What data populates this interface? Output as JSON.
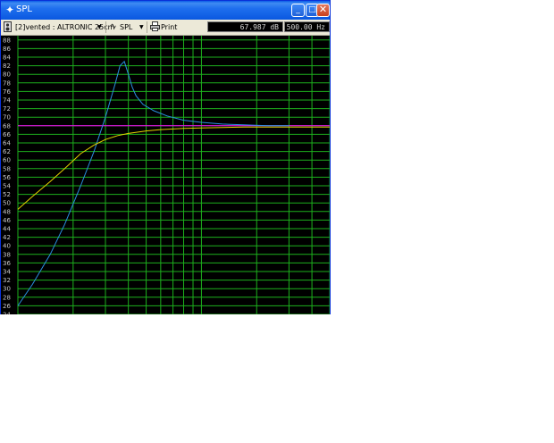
{
  "window": {
    "title": "SPL",
    "controls": {
      "minimize": "_",
      "maximize": "□",
      "close": "✕"
    }
  },
  "toolbar": {
    "driver_select": "[2]vented : ALTRONIC 25cm",
    "mode_select": "SPL",
    "print_label": "Print",
    "readout_db": "67.987 dB",
    "readout_hz": "500.00 Hz"
  },
  "icons": {
    "window_icon": "crosshair-icon",
    "driver_icon": "speaker-icon",
    "mode_icon": "wave-icon",
    "print_icon": "printer-icon",
    "dropdown_icon": "triangle-down-icon"
  },
  "colors": {
    "plot_background": "#000000",
    "grid": "#1db01d",
    "reference_line": "#ff00ff",
    "blue_curve": "#2a8fe0",
    "yellow_curve": "#e6d200"
  },
  "chart_data": {
    "type": "line",
    "y_ticks": [
      "88",
      "86",
      "84",
      "82",
      "80",
      "78",
      "76",
      "74",
      "72",
      "70",
      "68",
      "66",
      "64",
      "62",
      "60",
      "58",
      "56",
      "54",
      "52",
      "50",
      "48",
      "46",
      "44",
      "42",
      "40",
      "38",
      "36",
      "34",
      "32",
      "30",
      "28",
      "26",
      "24"
    ],
    "ylim": [
      24,
      89
    ],
    "xscale": "log",
    "xlim": [
      10,
      500
    ],
    "reference_level_db": 68,
    "series": [
      {
        "color": "#2a8fe0",
        "x": [
          10,
          12,
          15,
          18,
          22,
          26,
          30,
          34,
          36,
          38,
          40,
          42,
          44,
          48,
          55,
          65,
          80,
          100,
          130,
          170,
          230,
          300
        ],
        "y": [
          26,
          31,
          38,
          45,
          54,
          62,
          70,
          78,
          82,
          83,
          80,
          77,
          75,
          73,
          71.5,
          70.3,
          69.3,
          68.8,
          68.4,
          68.2,
          68.0,
          68.0
        ]
      },
      {
        "color": "#e6d200",
        "x": [
          10,
          12,
          15,
          18,
          22,
          26,
          30,
          35,
          40,
          50,
          60,
          80,
          100,
          130,
          170,
          230,
          300,
          400,
          500
        ],
        "y": [
          48.5,
          51.5,
          55,
          58,
          61.5,
          63.5,
          64.8,
          65.7,
          66.2,
          66.8,
          67.1,
          67.4,
          67.5,
          67.6,
          67.7,
          67.7,
          67.7,
          67.7,
          67.7
        ]
      }
    ]
  }
}
